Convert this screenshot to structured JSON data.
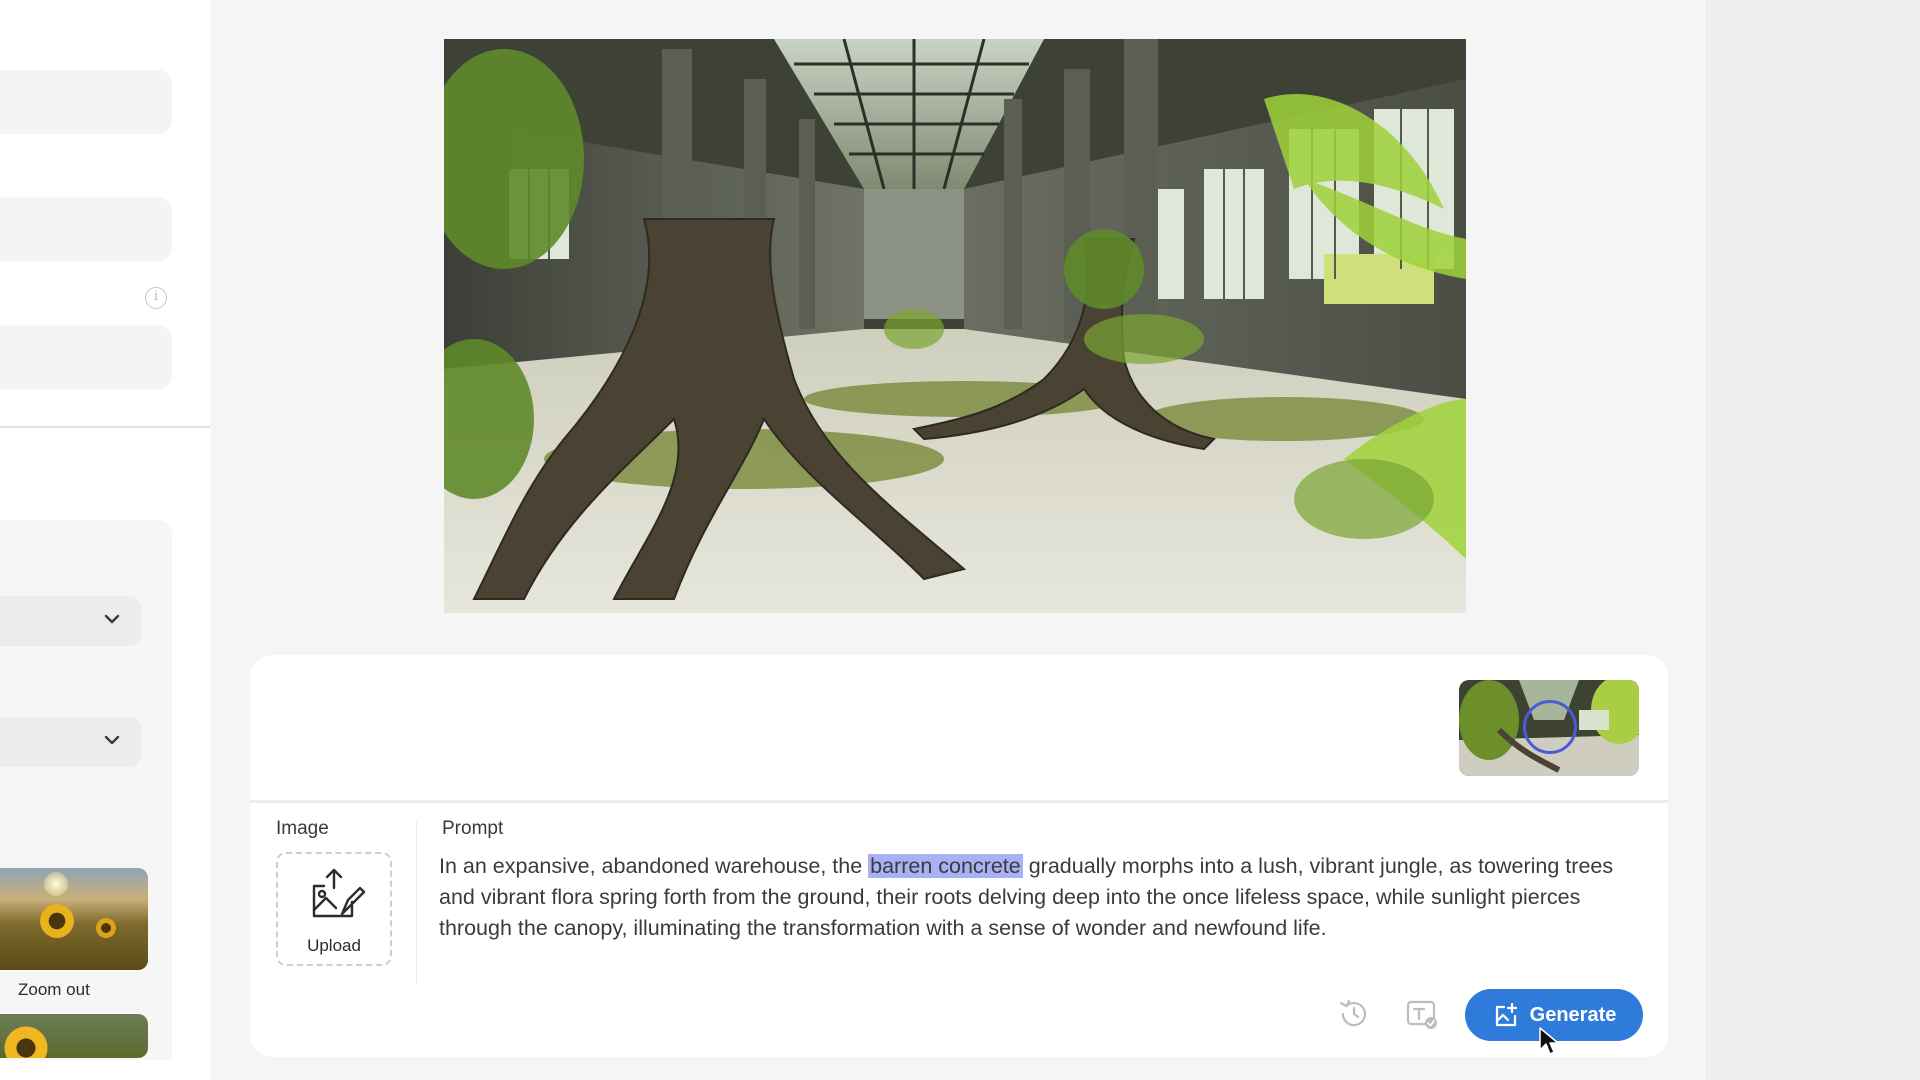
{
  "colors": {
    "accent": "#2f7bdc",
    "highlight": "#a7b1f3",
    "cursor_ring": "#4a5bd8"
  },
  "sidebar": {
    "thumbnails": [
      {
        "label": "Zoom out",
        "icon": "sunflower-field-thumbnail"
      },
      {
        "label": "",
        "icon": "sunflower-thumbnail"
      }
    ]
  },
  "main_image": {
    "icon": "overgrown-warehouse-jungle-image"
  },
  "prompt_panel": {
    "image_label": "Image",
    "upload_label": "Upload",
    "prompt_label": "Prompt",
    "prompt_before": "In an expansive, abandoned warehouse, the ",
    "prompt_highlight": "barren concrete",
    "prompt_after": " gradually morphs into a lush, vibrant jungle, as towering trees and vibrant flora spring forth from the ground, their roots delving deep into the once lifeless space, while sunlight pierces through the canopy, illuminating the transformation with a sense of wonder and newfound life.",
    "generate_label": "Generate",
    "tools": [
      "history-icon",
      "text-check-icon",
      "generate-icon"
    ]
  }
}
